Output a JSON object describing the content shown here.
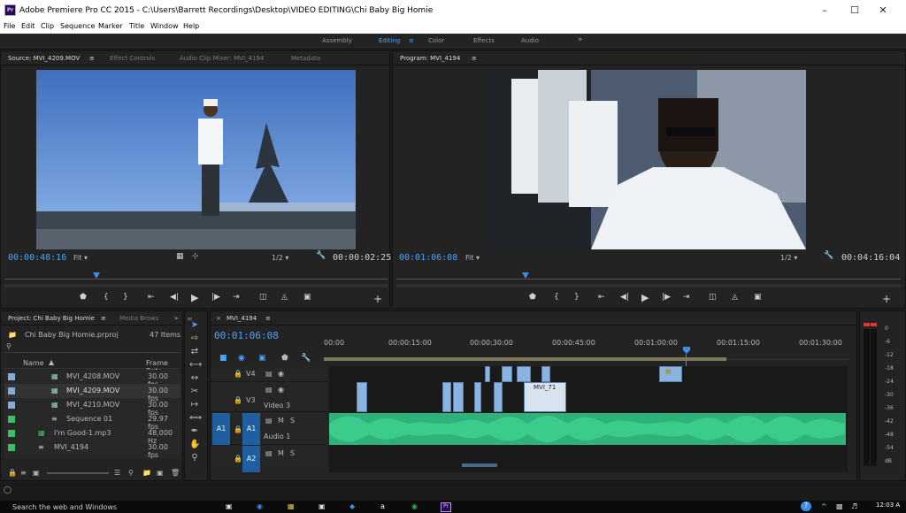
{
  "window": {
    "title": "Adobe Premiere Pro CC 2015 - C:\\Users\\Barrett Recordings\\Desktop\\VIDEO EDITING\\Chi Baby Big Homie",
    "logo": "Pr"
  },
  "menu": [
    "File",
    "Edit",
    "Clip",
    "Sequence",
    "Marker",
    "Title",
    "Window",
    "Help"
  ],
  "workspaces": {
    "items": [
      "Assembly",
      "Editing",
      "Color",
      "Effects",
      "Audio"
    ],
    "active": "Editing",
    "more": "»"
  },
  "source": {
    "tabs": [
      "Source: MVI_4209.MOV",
      "Effect Controls",
      "Audio Clip Mixer: MVI_4194",
      "Metadata"
    ],
    "timecode": "00:00:48:16",
    "fit": "Fit",
    "res": "1/2",
    "duration": "00:00:02:25"
  },
  "program": {
    "tab": "Program: MVI_4194",
    "timecode": "00:01:06:08",
    "fit": "Fit",
    "res": "1/2",
    "duration": "00:04:16:04"
  },
  "project": {
    "tabs": [
      "Project: Chi Baby Big Homie",
      "Media Brows"
    ],
    "file": "Chi Baby Big Homie.prproj",
    "count": "47 Items",
    "col_name": "Name",
    "col_rate": "Frame Rate",
    "items": [
      {
        "name": "MVI_4208.MOV",
        "rate": "30.00 fps",
        "color": "#8aa8d8"
      },
      {
        "name": "MVI_4209.MOV",
        "rate": "30.00 fps",
        "color": "#8aa8d8"
      },
      {
        "name": "MVI_4210.MOV",
        "rate": "30.00 fps",
        "color": "#8aa8d8"
      },
      {
        "name": "Sequence 01",
        "rate": "29.97 fps",
        "color": "#3fbf5f"
      },
      {
        "name": "I'm Good-1.mp3",
        "rate": "48,000 Hz",
        "color": "#3fbf5f"
      },
      {
        "name": "MVI_4194",
        "rate": "30.00 fps",
        "color": "#3fbf5f"
      }
    ]
  },
  "timeline": {
    "tab": "MVI_4194",
    "timecode": "00:01:06:08",
    "ruler": [
      "00:00",
      "00:00:15:00",
      "00:00:30:00",
      "00:00:45:00",
      "00:01:00:00",
      "00:01:15:00",
      "00:01:30:00"
    ],
    "tracks": {
      "v4": "V4",
      "v3": "V3",
      "v3name": "Video 3",
      "a1": "A1",
      "a1name": "Audio 1",
      "a2": "A2",
      "a1src": "A1"
    },
    "clip_label": "MVI_71"
  },
  "meter": {
    "ticks": [
      "0",
      "-6",
      "-12",
      "-18",
      "-24",
      "-30",
      "-36",
      "-42",
      "-48",
      "-54",
      "dB"
    ]
  },
  "taskbar": {
    "search": "Search the web and Windows",
    "time": "12:03 A"
  }
}
